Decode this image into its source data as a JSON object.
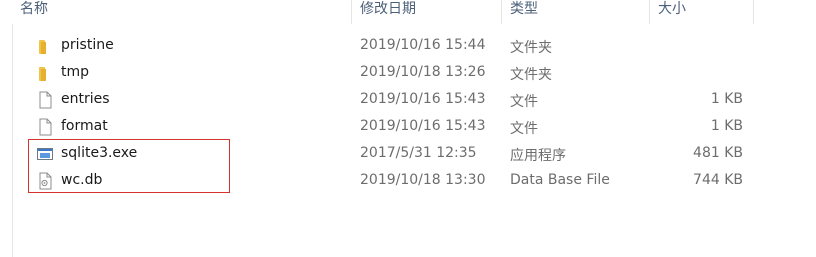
{
  "columns": {
    "name": "名称",
    "date": "修改日期",
    "type": "类型",
    "size": "大小"
  },
  "files": [
    {
      "name": "pristine",
      "date": "2019/10/16 15:44",
      "type": "文件夹",
      "size": "",
      "icon": "folder-icon"
    },
    {
      "name": "tmp",
      "date": "2019/10/18 13:26",
      "type": "文件夹",
      "size": "",
      "icon": "folder-icon"
    },
    {
      "name": "entries",
      "date": "2019/10/16 15:43",
      "type": "文件",
      "size": "1 KB",
      "icon": "file-icon"
    },
    {
      "name": "format",
      "date": "2019/10/16 15:43",
      "type": "文件",
      "size": "1 KB",
      "icon": "file-icon"
    },
    {
      "name": "sqlite3.exe",
      "date": "2017/5/31 12:35",
      "type": "应用程序",
      "size": "481 KB",
      "icon": "exe-icon"
    },
    {
      "name": "wc.db",
      "date": "2019/10/18 13:30",
      "type": "Data Base File",
      "size": "744 KB",
      "icon": "db-file-icon"
    }
  ],
  "colors": {
    "header_text": "#4c607a",
    "folder": "#f0c44b",
    "highlight_box": "#d4312f"
  }
}
